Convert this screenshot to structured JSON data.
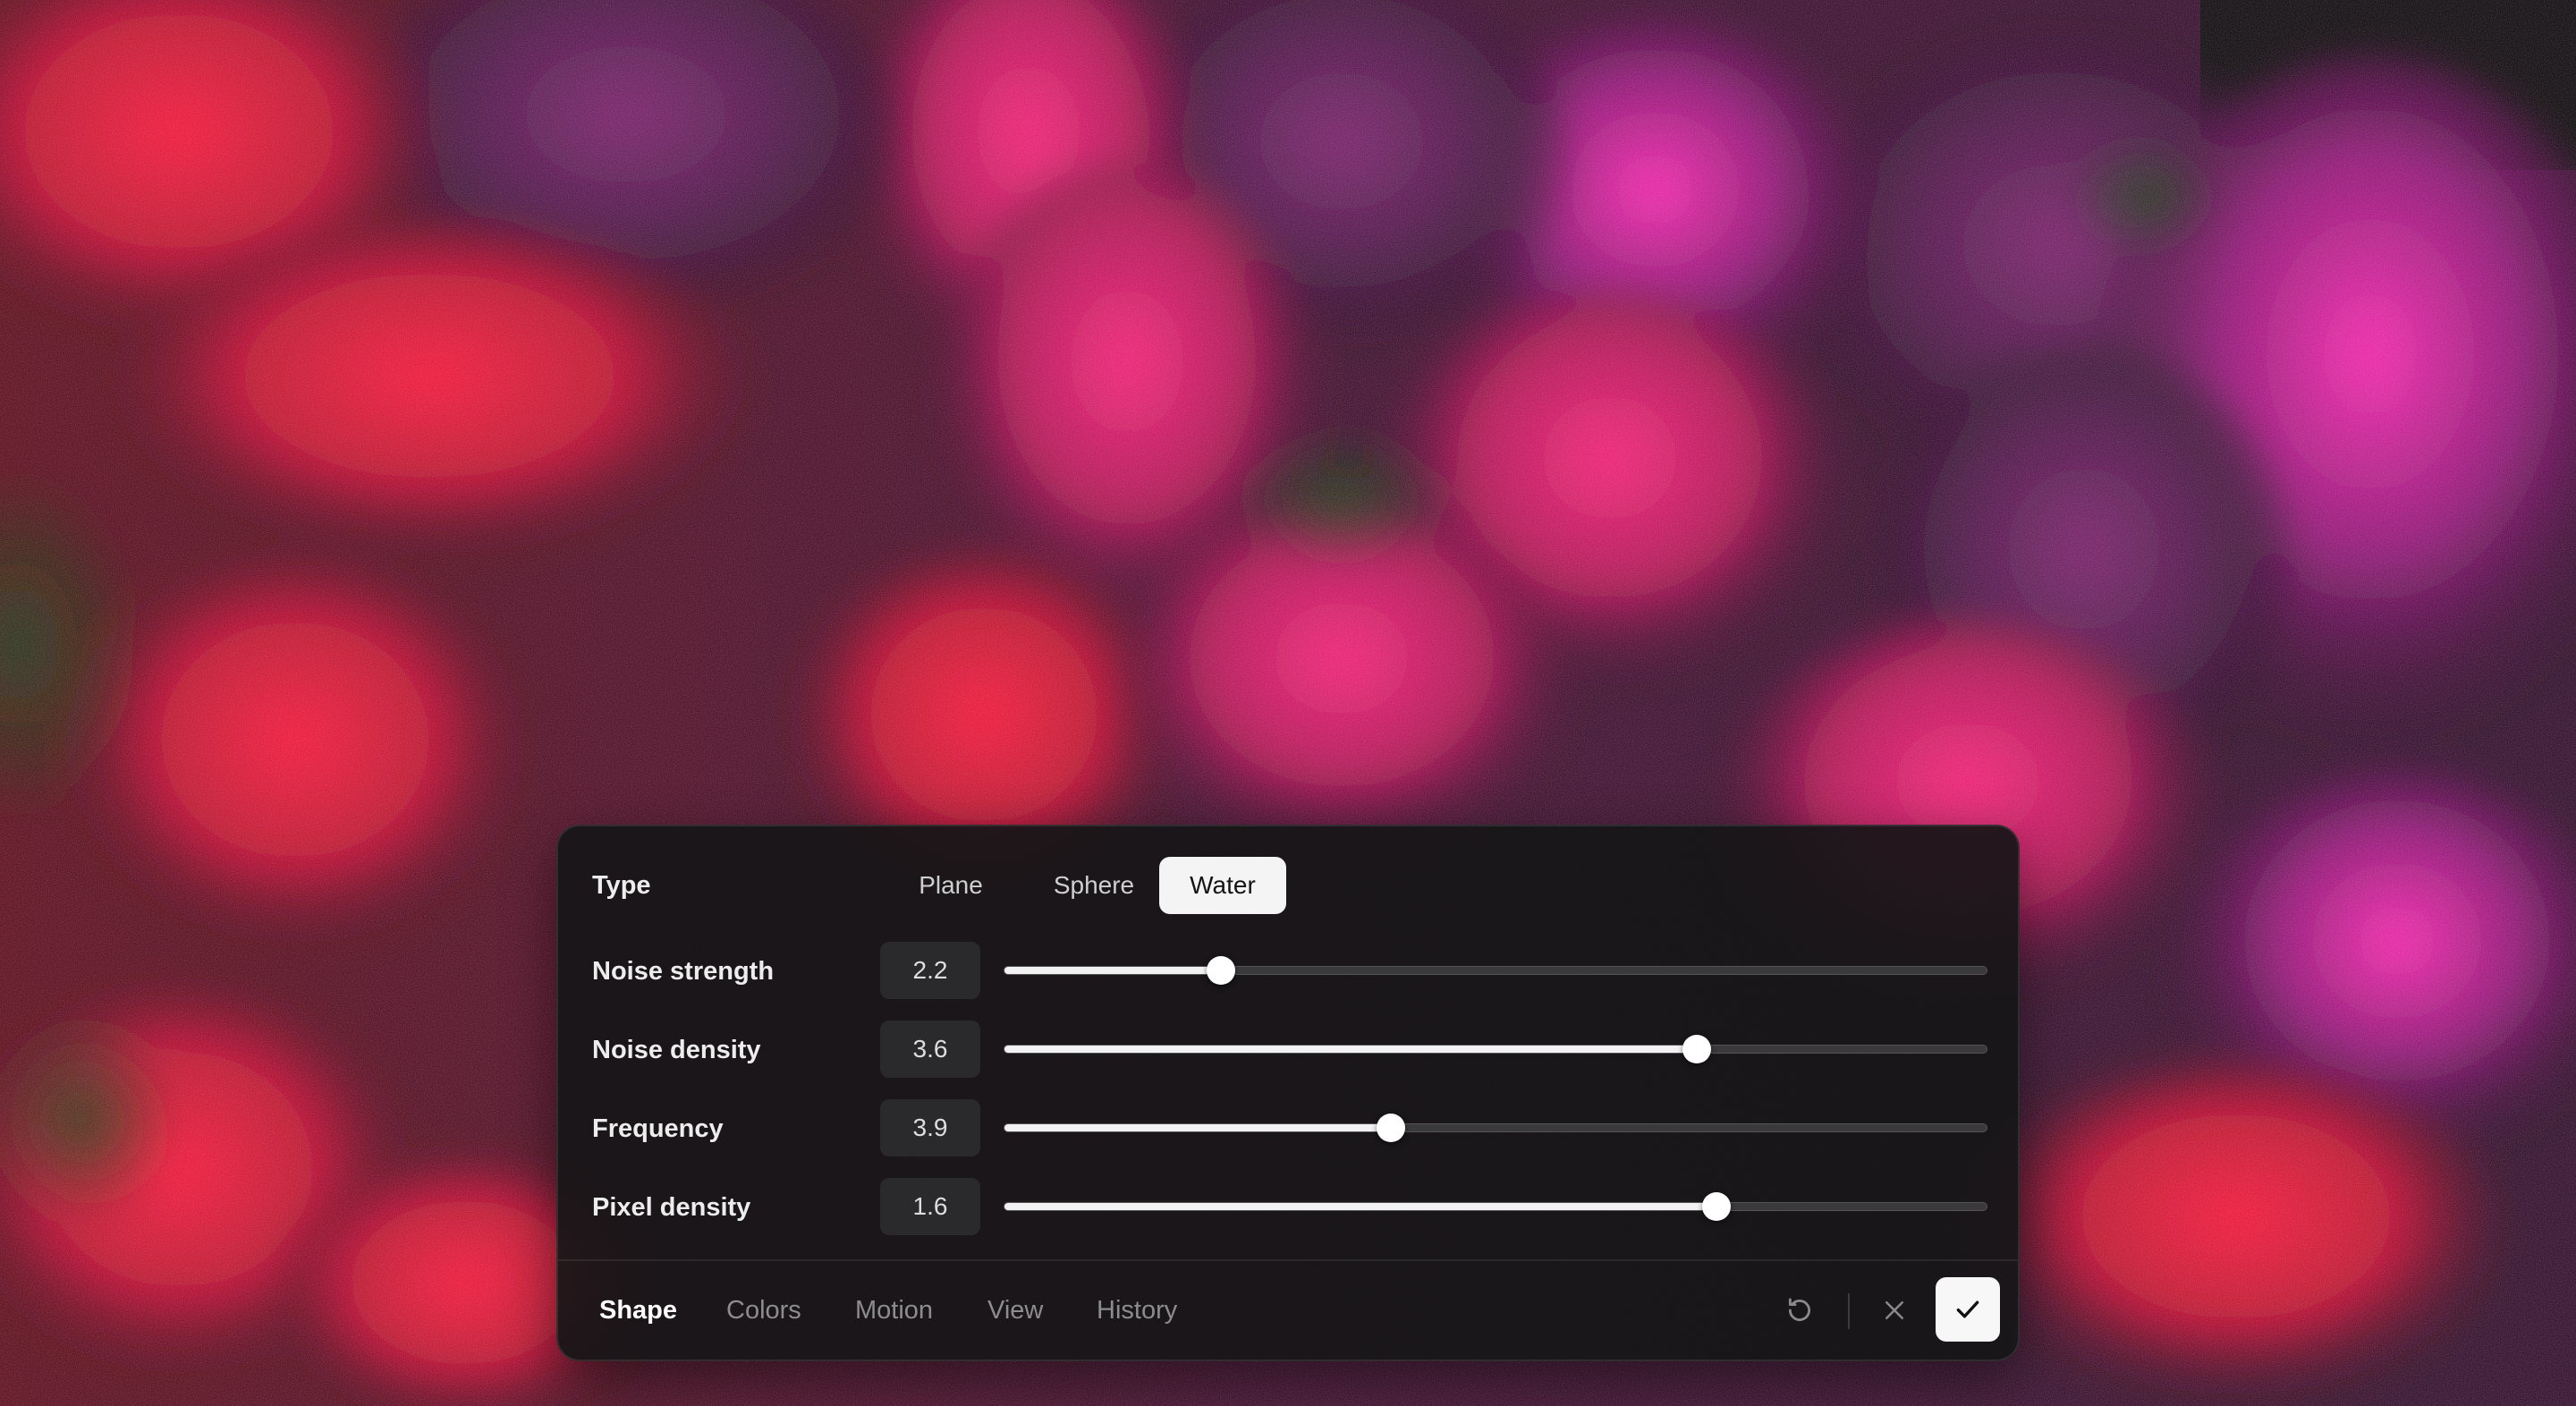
{
  "type_row": {
    "label": "Type",
    "options": [
      "Plane",
      "Sphere",
      "Water"
    ],
    "selected": "Water"
  },
  "sliders": [
    {
      "label": "Noise strength",
      "value": "2.2",
      "fraction": 0.22
    },
    {
      "label": "Noise density",
      "value": "3.6",
      "fraction": 0.705
    },
    {
      "label": "Frequency",
      "value": "3.9",
      "fraction": 0.393
    },
    {
      "label": "Pixel density",
      "value": "1.6",
      "fraction": 0.725
    }
  ],
  "footer": {
    "tabs": [
      "Shape",
      "Colors",
      "Motion",
      "View",
      "History"
    ],
    "active_tab": "Shape"
  },
  "icons": {
    "reset": "reset-icon",
    "close": "close-icon",
    "confirm": "check-icon"
  },
  "colors": {
    "accent": "#f4f4f4",
    "panel_bg": "#161517",
    "scene_red": "#ff0a2e",
    "scene_magenta": "#ff1aa0"
  }
}
